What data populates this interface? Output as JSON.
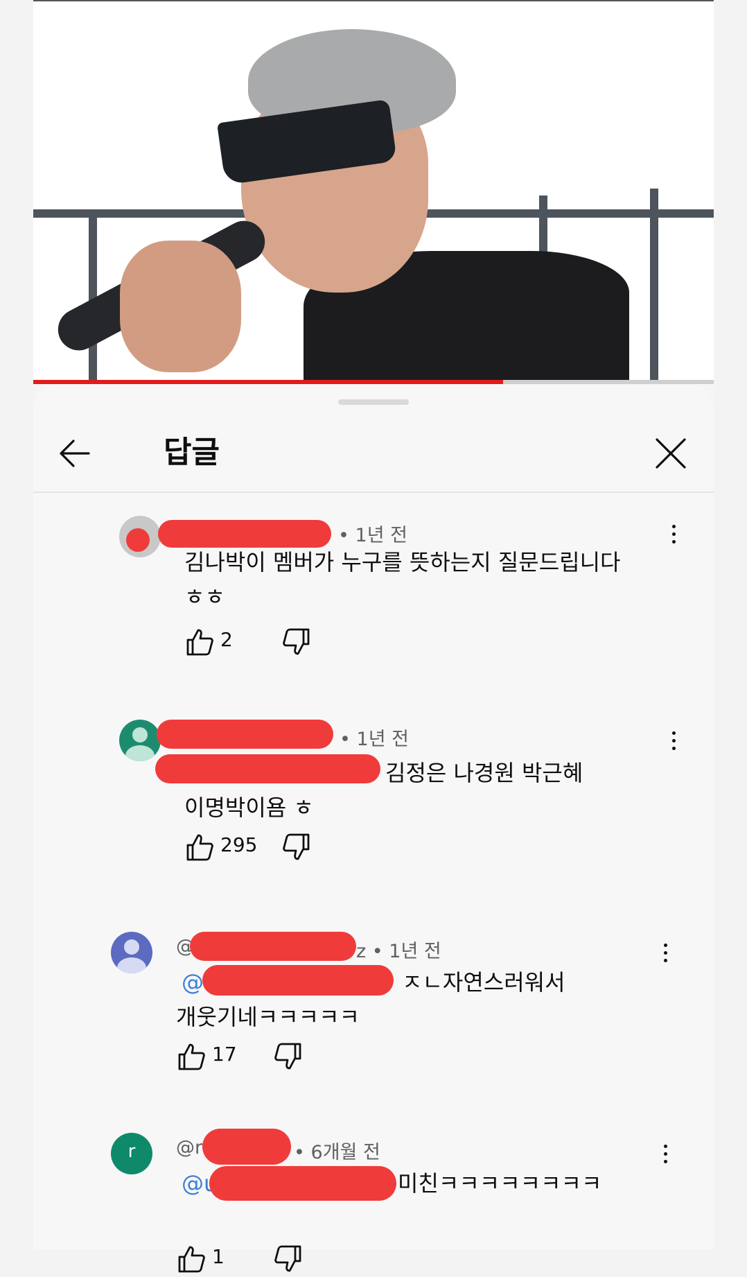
{
  "sheet": {
    "title": "답글"
  },
  "video": {
    "progress": 0.69
  },
  "comments": [
    {
      "author_prefix": "",
      "author_suffix": "",
      "time": "1년 전",
      "mention": "",
      "text": "김나박이 멤버가 누구를 뜻하는지 질문드립니다\nㅎㅎ",
      "likes": "2",
      "avatar_letter": "",
      "avatar_color": "#bfbfbf"
    },
    {
      "author_prefix": "",
      "author_suffix": "",
      "time": "1년 전",
      "mention": "",
      "text": "김정은 나경원 박근혜\n이명박이욤 ㅎ",
      "likes": "295",
      "avatar_letter": "",
      "avatar_color": "#1d8c6e"
    },
    {
      "author_prefix": "@",
      "author_suffix": "z",
      "time": "1년 전",
      "mention": "@",
      "text": "ㅈㄴ자연스러워서\n개웃기네ㅋㅋㅋㅋㅋ",
      "likes": "17",
      "avatar_letter": "",
      "avatar_color": "#5c6bc0"
    },
    {
      "author_prefix": "@r",
      "author_suffix": "",
      "time": "6개월 전",
      "mention": "@u",
      "text": "미친ㅋㅋㅋㅋㅋㅋㅋㅋ",
      "likes": "1",
      "avatar_letter": "r",
      "avatar_color": "#0e8a6a"
    }
  ]
}
